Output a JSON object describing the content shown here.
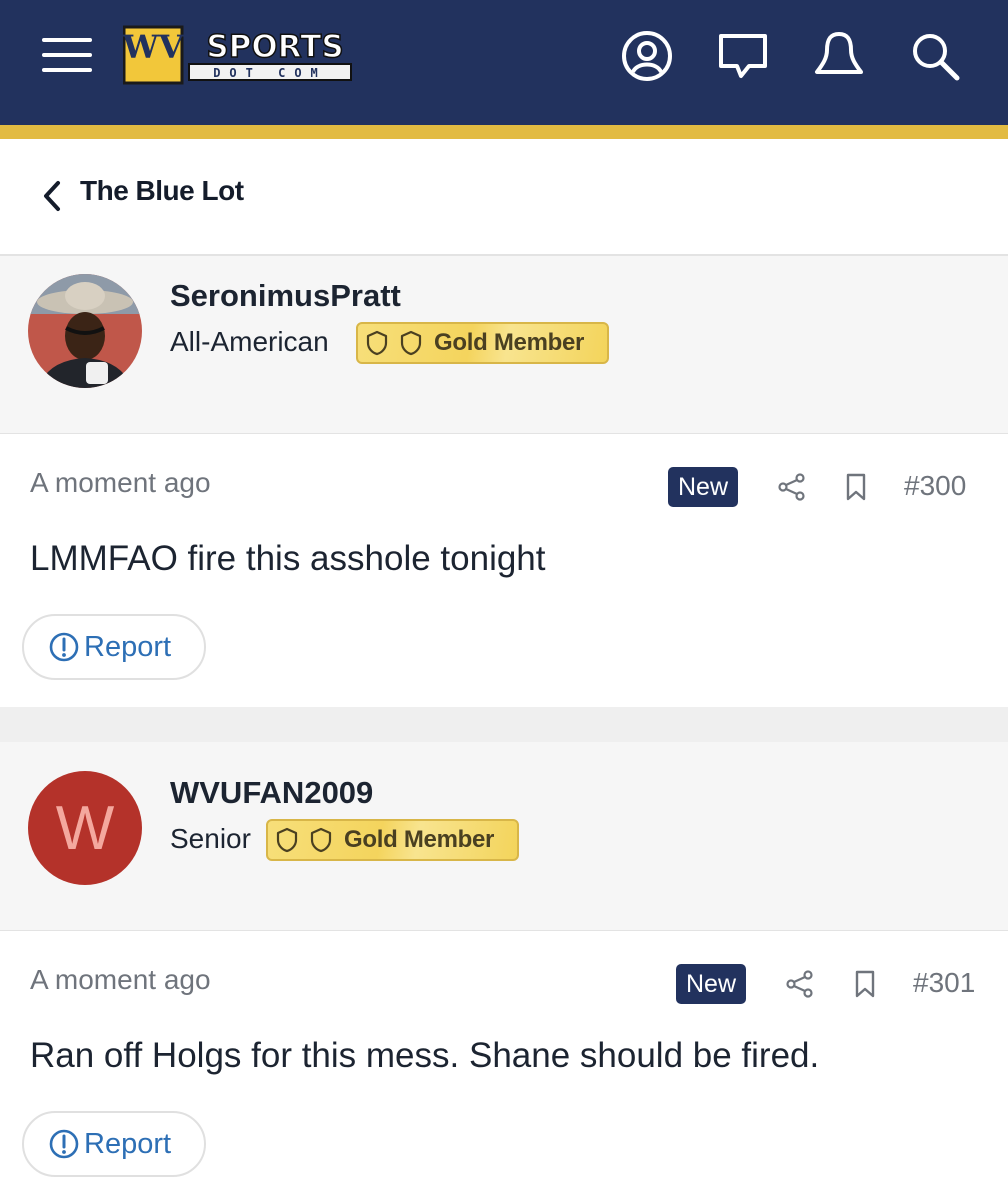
{
  "header": {
    "logo_main": "SPORTS",
    "logo_sub": "DOT COM",
    "logo_letters": "WV",
    "icons": [
      "menu-icon",
      "account-icon",
      "messages-icon",
      "alerts-icon",
      "search-icon"
    ],
    "colors": {
      "navy": "#22325e",
      "gold": "#e2bb42"
    }
  },
  "breadcrumb": {
    "label": "The Blue Lot"
  },
  "posts": [
    {
      "username": "SeronimusPratt",
      "rank": "All-American",
      "badge": "Gold Member",
      "avatar": "photo",
      "timestamp": "A moment ago",
      "new_label": "New",
      "post_number": "#300",
      "content": "LMMFAO fire this asshole tonight",
      "report_label": "Report"
    },
    {
      "username": "WVUFAN2009",
      "rank": "Senior",
      "badge": "Gold Member",
      "avatar": "W",
      "avatar_color": "#b4322a",
      "timestamp": "A moment ago",
      "new_label": "New",
      "post_number": "#301",
      "content": "Ran off Holgs for this mess. Shane should be fired.",
      "report_label": "Report"
    }
  ]
}
